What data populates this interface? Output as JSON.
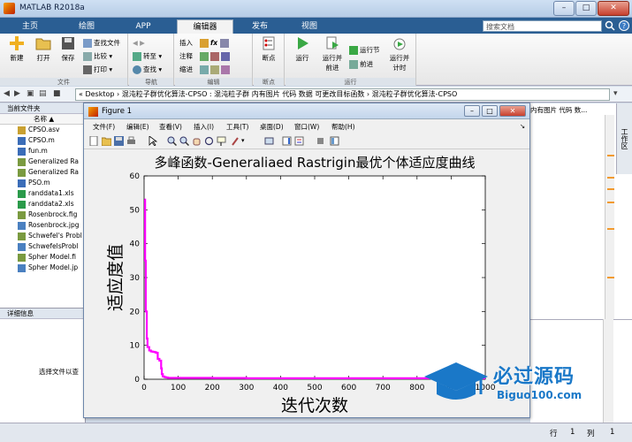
{
  "window": {
    "title": "MATLAB R2018a",
    "min": "–",
    "max": "□",
    "close": "✕"
  },
  "tabs": [
    {
      "label": "主页",
      "active": false
    },
    {
      "label": "绘图",
      "active": false
    },
    {
      "label": "APP",
      "active": false
    },
    {
      "label": "编辑器",
      "active": true
    },
    {
      "label": "发布",
      "active": false
    },
    {
      "label": "视图",
      "active": false
    }
  ],
  "search": {
    "placeholder": "搜索文档"
  },
  "ribbon": {
    "file_group": "文件",
    "nav_group": "导航",
    "edit_group": "编辑",
    "breakpoint_group": "断点",
    "run_group": "运行",
    "new": "新建",
    "open": "打开",
    "save": "保存",
    "find_files": "查找文件",
    "compare": "比较",
    "print": "打印",
    "goto": "转至",
    "find": "查找",
    "insert": "插入",
    "comment": "注释",
    "indent": "缩进",
    "fx": "fx",
    "breakpoints": "断点",
    "run": "运行",
    "run_advance": "运行并\n前进",
    "run_section": "运行节",
    "advance": "前进",
    "run_time": "运行并\n计时"
  },
  "address": {
    "path": "« Desktop › 混沌粒子群优化算法-CPSO : 混沌粒子群 内有图片 代码 数据 可更改目标函数 › 混沌粒子群优化算法-CPSO"
  },
  "filepanel": {
    "header": "当前文件夹",
    "col_name": "名称 ▲",
    "files": [
      "CPSO.asv",
      "CPSO.m",
      "fun.m",
      "Generalized Ra",
      "Generalized Ra",
      "PSO.m",
      "randdata1.xls",
      "randdata2.xls",
      "Rosenbrock.fig",
      "Rosenbrock.jpg",
      "Schwefel's Probl",
      "SchwefelsProbl",
      "Spher Model.fi",
      "Spher Model.jp"
    ]
  },
  "detail": {
    "header": "详细信息",
    "hint": "选择文件以查"
  },
  "rightpanel": {
    "text": "内有图片 代码 数...",
    "workspace": "工作区"
  },
  "statusbar": {
    "row_label": "行",
    "row": "1",
    "col_label": "列",
    "col": "1"
  },
  "figure": {
    "title": "Figure 1",
    "menus": [
      "文件(F)",
      "编辑(E)",
      "查看(V)",
      "插入(I)",
      "工具(T)",
      "桌面(D)",
      "窗口(W)",
      "帮助(H)"
    ]
  },
  "chart_data": {
    "type": "line",
    "title": "多峰函数-Generaliaed Rastrigin最优个体适应度曲线",
    "xlabel": "迭代次数",
    "ylabel": "适应度值",
    "xlim": [
      0,
      1000
    ],
    "ylim": [
      0,
      60
    ],
    "xticks": [
      0,
      100,
      200,
      300,
      400,
      500,
      600,
      700,
      800,
      900,
      1000
    ],
    "yticks": [
      0,
      10,
      20,
      30,
      40,
      50,
      60
    ],
    "grid": false,
    "color": "#ff00ff",
    "series": [
      {
        "x": [
          1,
          3,
          5,
          8,
          10,
          15,
          20,
          25,
          30,
          35,
          40,
          45,
          50,
          52,
          55,
          60,
          65,
          70,
          100,
          200,
          300,
          500,
          700,
          900,
          1000
        ],
        "y": [
          53,
          35,
          20,
          12,
          9.5,
          8.5,
          8.2,
          8.1,
          8,
          7.8,
          6,
          5.5,
          3.2,
          1.5,
          0.8,
          0.6,
          0.5,
          0.4,
          0.4,
          0.35,
          0.3,
          0.3,
          0.3,
          0.3,
          0.3
        ]
      }
    ]
  },
  "watermark": {
    "text": "必过源码",
    "sub": "Biguo100.com"
  }
}
